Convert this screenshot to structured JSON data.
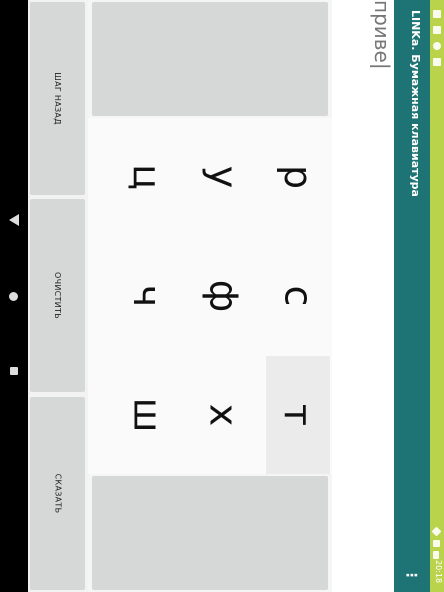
{
  "status_bar": {
    "time": "20:18"
  },
  "app_bar": {
    "title": "LINKa. Бумажная клавиатура",
    "menu_icon": "more-vert-icon"
  },
  "text_field": {
    "value": "приве|"
  },
  "actions": {
    "undo_label": "ШАГ НАЗАД",
    "clear_label": "ОЧИСТИТЬ",
    "speak_label": "СКАЗАТЬ"
  },
  "keyboard": {
    "keys": [
      {
        "char": "р",
        "selected": false
      },
      {
        "char": "у",
        "selected": false
      },
      {
        "char": "ц",
        "selected": false
      },
      {
        "char": "с",
        "selected": false
      },
      {
        "char": "ф",
        "selected": false
      },
      {
        "char": "ч",
        "selected": false
      },
      {
        "char": "т",
        "selected": true
      },
      {
        "char": "х",
        "selected": false
      },
      {
        "char": "ш",
        "selected": false
      }
    ]
  },
  "colors": {
    "app_bar": "#1e7474",
    "status_bar": "#b9d34a",
    "key_button": "#d6d8d7"
  }
}
